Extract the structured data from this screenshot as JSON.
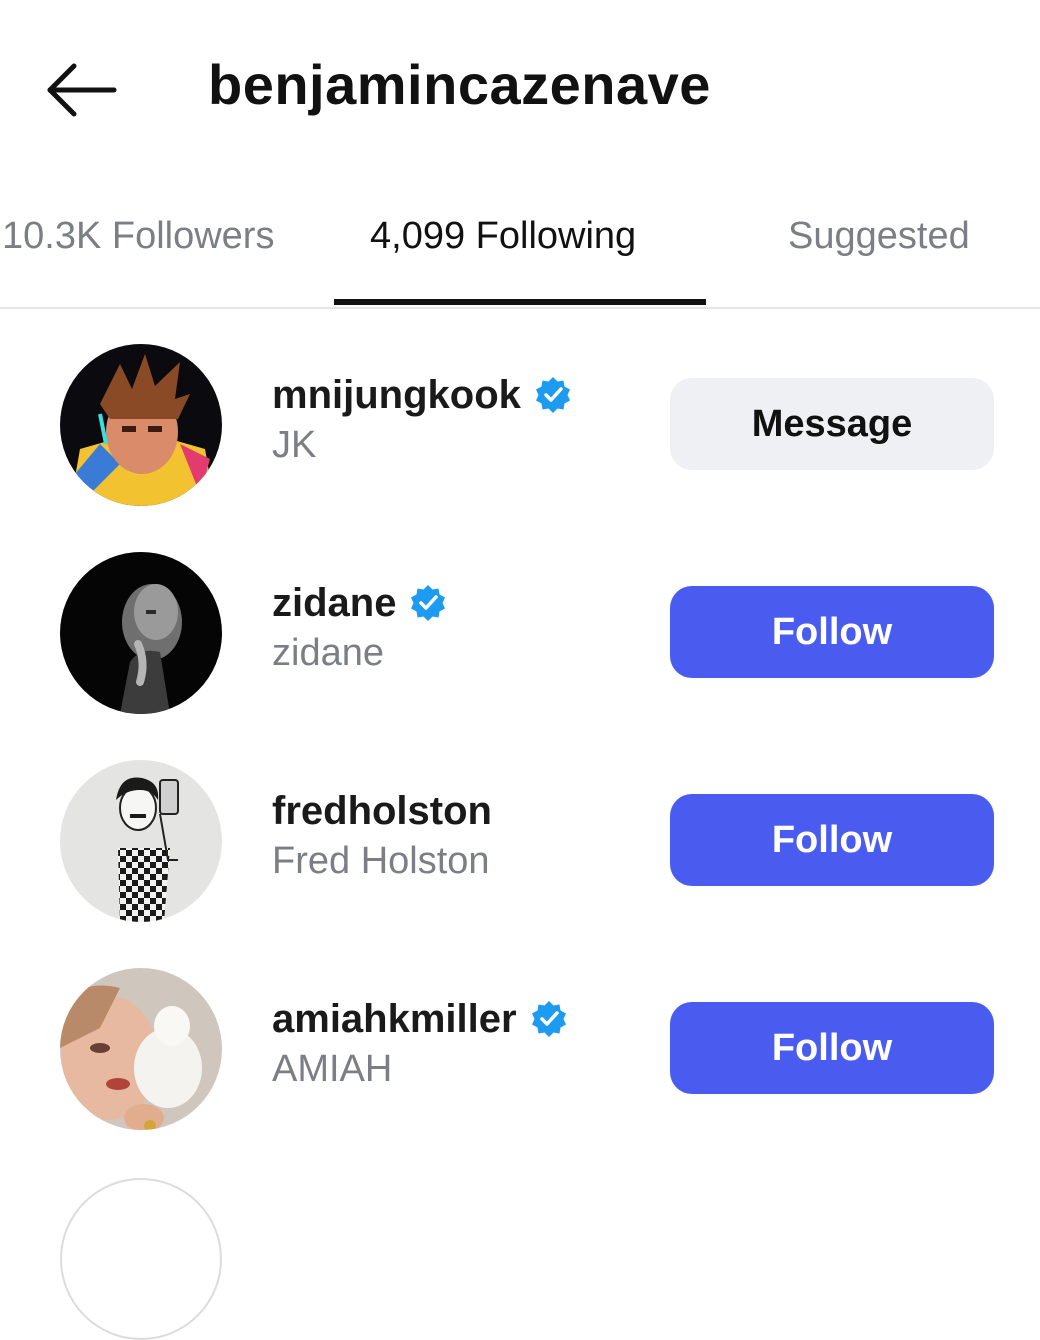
{
  "header": {
    "back_icon": "arrow-left-icon",
    "username": "benjamincazenave"
  },
  "tabs": [
    {
      "label": "10.3K Followers",
      "active": false
    },
    {
      "label": "4,099 Following",
      "active": true
    },
    {
      "label": "Suggested",
      "active": false
    }
  ],
  "accounts": [
    {
      "handle": "mnijungkook",
      "name": "JK",
      "verified": true,
      "button": "Message",
      "button_style": "secondary"
    },
    {
      "handle": "zidane",
      "name": "zidane",
      "verified": true,
      "button": "Follow",
      "button_style": "primary"
    },
    {
      "handle": "fredholston",
      "name": "Fred Holston",
      "verified": false,
      "button": "Follow",
      "button_style": "primary"
    },
    {
      "handle": "amiahkmiller",
      "name": "AMIAH",
      "verified": true,
      "button": "Follow",
      "button_style": "primary"
    }
  ],
  "colors": {
    "accent": "#4a5cf0",
    "verified_badge": "#1d9bf0",
    "secondary_text": "#7b7f85",
    "message_button_bg": "#eff0f3"
  }
}
